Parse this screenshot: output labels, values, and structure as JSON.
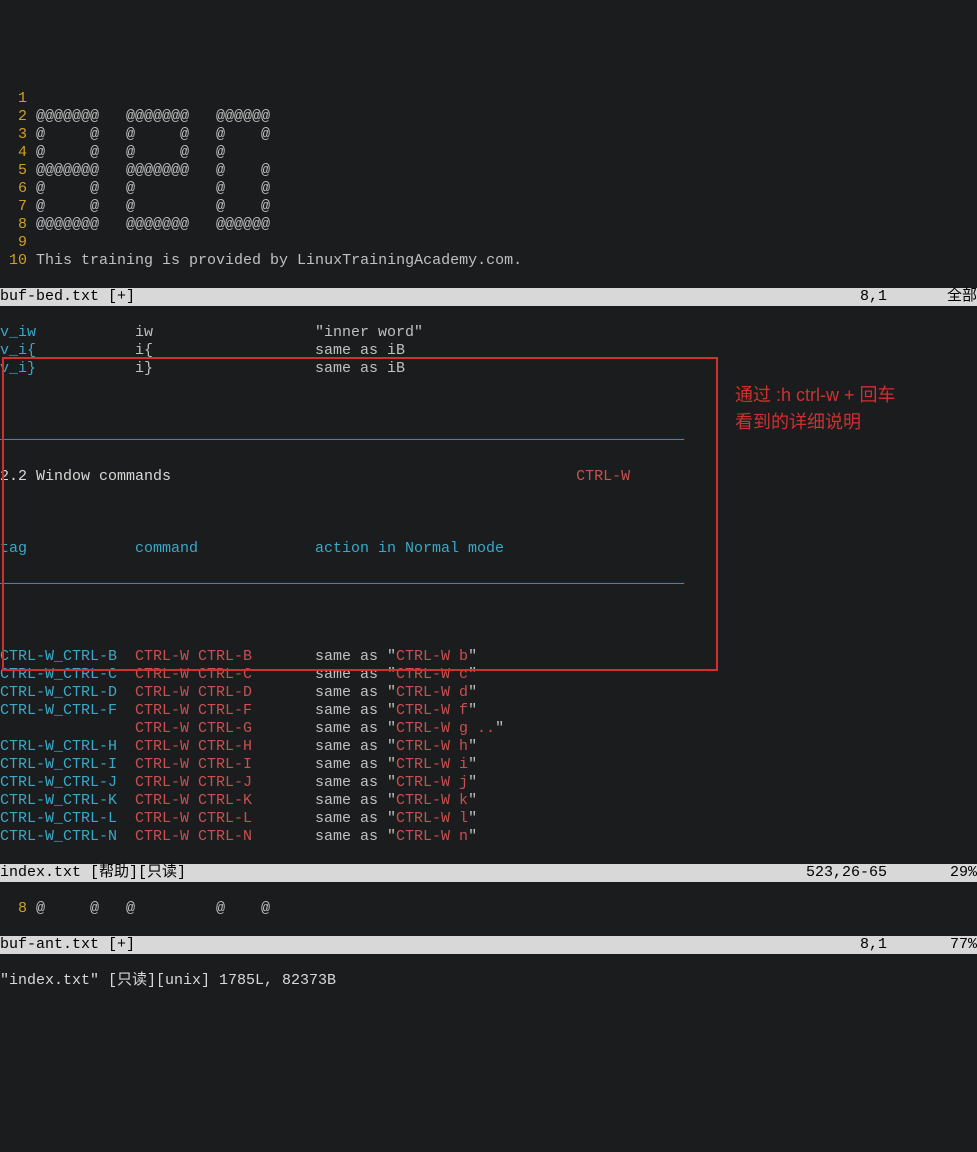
{
  "top": {
    "lines": [
      {
        "n": "1",
        "t": ""
      },
      {
        "n": "2",
        "t": "@@@@@@@   @@@@@@@   @@@@@@"
      },
      {
        "n": "3",
        "t": "@     @   @     @   @    @"
      },
      {
        "n": "4",
        "t": "@     @   @     @   @"
      },
      {
        "n": "5",
        "t": "@@@@@@@   @@@@@@@   @    @"
      },
      {
        "n": "6",
        "t": "@     @   @         @    @"
      },
      {
        "n": "7",
        "t": "@     @   @         @    @"
      },
      {
        "n": "8",
        "t": "@@@@@@@   @@@@@@@   @@@@@@"
      },
      {
        "n": "9",
        "t": ""
      },
      {
        "n": "10",
        "t": "This training is provided by LinuxTrainingAcademy.com."
      }
    ]
  },
  "status1": {
    "left": "buf-bed.txt [+]",
    "pos": "8,1",
    "right": "全部"
  },
  "textobj": [
    {
      "tag": "v_iw",
      "cmd": "iw",
      "desc": "\"inner word\""
    },
    {
      "tag": "v_i{",
      "cmd": "i{",
      "desc": "same as iB"
    },
    {
      "tag": "v_i}",
      "cmd": "i}",
      "desc": "same as iB"
    }
  ],
  "ruler": "────────────────────────────────────────────────────────────────────────────",
  "section": {
    "num": "2.2",
    "title": "Window commands",
    "key": "CTRL-W"
  },
  "headers": {
    "tag": "tag",
    "cmd": "command",
    "action": "action in Normal mode"
  },
  "underline": "────────────────────────────────────────────────────────────────────────────",
  "cmds": [
    {
      "tag": "CTRL-W_CTRL-B",
      "cmd": "CTRL-W CTRL-B",
      "pre": "same as \"",
      "k": "CTRL-W b",
      "post": "\""
    },
    {
      "tag": "CTRL-W_CTRL-C",
      "cmd": "CTRL-W CTRL-C",
      "pre": "same as \"",
      "k": "CTRL-W c",
      "post": "\""
    },
    {
      "tag": "CTRL-W_CTRL-D",
      "cmd": "CTRL-W CTRL-D",
      "pre": "same as \"",
      "k": "CTRL-W d",
      "post": "\""
    },
    {
      "tag": "CTRL-W_CTRL-F",
      "cmd": "CTRL-W CTRL-F",
      "pre": "same as \"",
      "k": "CTRL-W f",
      "post": "\""
    },
    {
      "tag": "",
      "cmd": "CTRL-W CTRL-G",
      "pre": "same as \"",
      "k": "CTRL-W g ..",
      "post": "\""
    },
    {
      "tag": "CTRL-W_CTRL-H",
      "cmd": "CTRL-W CTRL-H",
      "pre": "same as \"",
      "k": "CTRL-W h",
      "post": "\""
    },
    {
      "tag": "CTRL-W_CTRL-I",
      "cmd": "CTRL-W CTRL-I",
      "pre": "same as \"",
      "k": "CTRL-W i",
      "post": "\""
    },
    {
      "tag": "CTRL-W_CTRL-J",
      "cmd": "CTRL-W CTRL-J",
      "pre": "same as \"",
      "k": "CTRL-W j",
      "post": "\""
    },
    {
      "tag": "CTRL-W_CTRL-K",
      "cmd": "CTRL-W CTRL-K",
      "pre": "same as \"",
      "k": "CTRL-W k",
      "post": "\""
    },
    {
      "tag": "CTRL-W_CTRL-L",
      "cmd": "CTRL-W CTRL-L",
      "pre": "same as \"",
      "k": "CTRL-W l",
      "post": "\""
    },
    {
      "tag": "CTRL-W_CTRL-N",
      "cmd": "CTRL-W CTRL-N",
      "pre": "same as \"",
      "k": "CTRL-W n",
      "post": "\""
    }
  ],
  "status2": {
    "left": "index.txt [帮助][只读]",
    "pos": "523,26-65",
    "right": "29%"
  },
  "bottom": {
    "n": "8",
    "t": "@     @   @         @    @"
  },
  "status3": {
    "left": "buf-ant.txt [+]",
    "pos": "8,1",
    "right": "77%"
  },
  "cmdline": "\"index.txt\" [只读][unix] 1785L, 82373B",
  "annotation": {
    "l1": "通过 :h ctrl-w + 回车",
    "l2": "看到的详细说明"
  }
}
